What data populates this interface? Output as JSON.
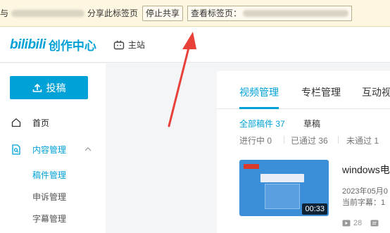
{
  "share_bar": {
    "prefix": "与",
    "suffix": "分享此标签页",
    "stop_label": "停止共享",
    "view_prefix": "查看标签页："
  },
  "topnav": {
    "logo_text": "bilibili",
    "logo_subtitle": "创作中心",
    "home_label": "主站"
  },
  "sidebar": {
    "upload_label": "投稿",
    "home_label": "首页",
    "content_label": "内容管理",
    "sub_items": [
      "稿件管理",
      "申诉管理",
      "字幕管理"
    ]
  },
  "main": {
    "tabs": [
      "视频管理",
      "专栏管理",
      "互动视"
    ],
    "filters_primary": [
      "全部稿件 37",
      "草稿"
    ],
    "filters_status": [
      "进行中 0",
      "已通过 36",
      "未通过 1"
    ],
    "video": {
      "title": "windows电脑",
      "date": "2023年05月0",
      "subtitle_line": "当前字幕：1",
      "duration": "00:33",
      "plays": "28"
    }
  },
  "colors": {
    "accent": "#00a1d6",
    "share_bar_bg": "#fdf6e0",
    "arrow": "#e8413a"
  }
}
